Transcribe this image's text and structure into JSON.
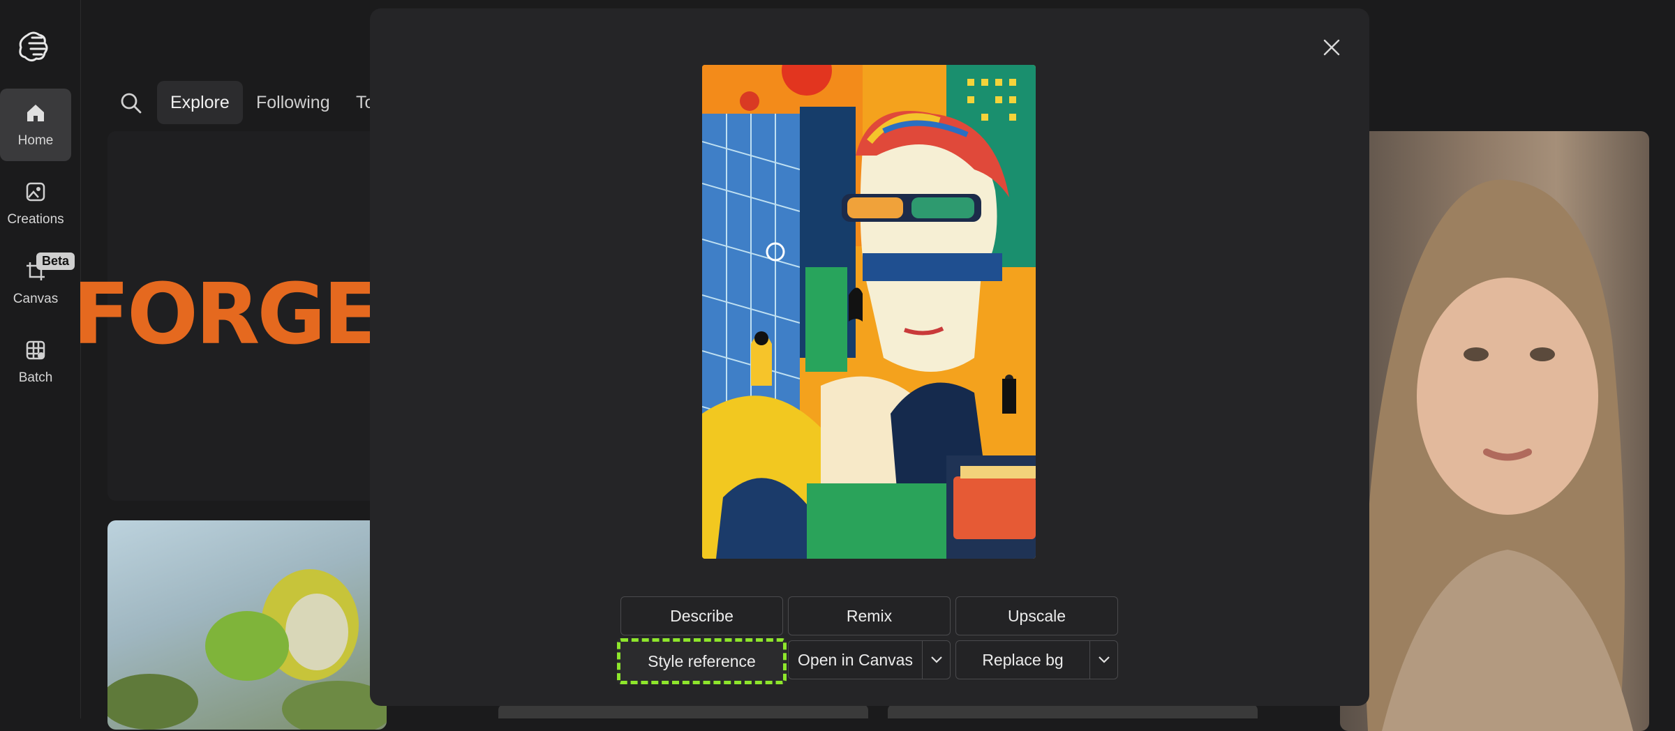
{
  "sidebar": {
    "items": [
      {
        "label": "Home",
        "icon": "home-icon"
      },
      {
        "label": "Creations",
        "icon": "image-icon"
      },
      {
        "label": "Canvas",
        "icon": "canvas-crop-icon",
        "badge": "Beta"
      },
      {
        "label": "Batch",
        "icon": "batch-grid-icon"
      }
    ]
  },
  "topbar": {
    "tabs": [
      "Explore",
      "Following",
      "To"
    ]
  },
  "background": {
    "forge_logo_text": "FORGE"
  },
  "modal": {
    "actions_row1": [
      "Describe",
      "Remix",
      "Upscale"
    ],
    "actions_row2": {
      "style_reference": "Style reference",
      "open_in_canvas": "Open in Canvas",
      "replace_bg": "Replace bg"
    }
  },
  "colors": {
    "accent_highlight": "#8ee62c",
    "background": "#1b1b1c",
    "modal": "#252527"
  }
}
